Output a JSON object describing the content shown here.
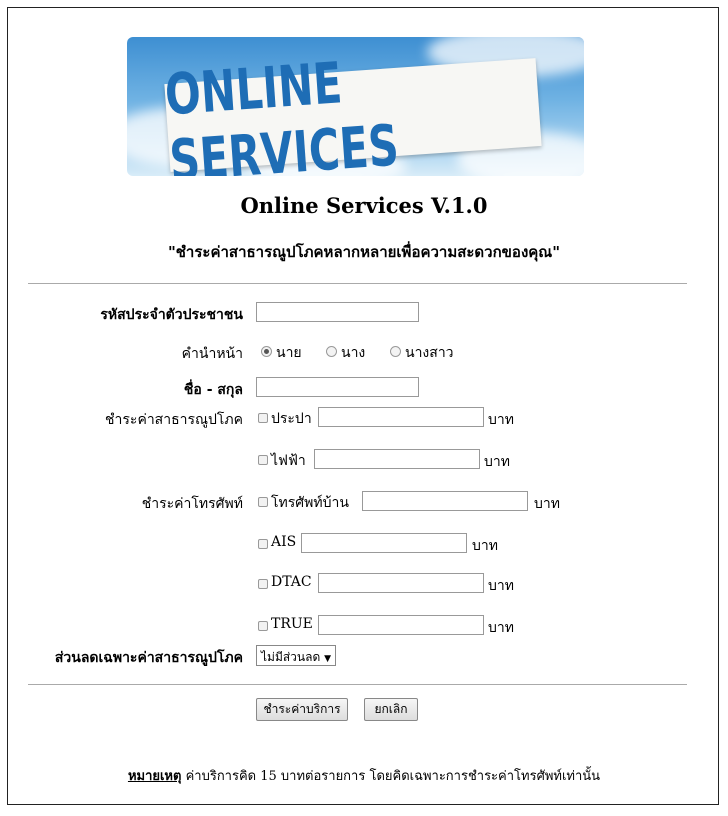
{
  "banner": {
    "text": "ONLINE SERVICES"
  },
  "header": {
    "title": "Online Services V.1.0",
    "slogan": "\"ชำระค่าสาธารณูปโภคหลากหลายเพื่อความสะดวกของคุณ\""
  },
  "form": {
    "id_label": "รหัสประจำตัวประชาชน",
    "prefix_label": "คำนำหน้า",
    "prefix_options": [
      "นาย",
      "นาง",
      "นางสาว"
    ],
    "prefix_selected": "นาย",
    "name_label": "ชื่อ - สกุล",
    "utility_label": "ชำระค่าสาธารณูปโภค",
    "phone_label": "ชำระค่าโทรศัพท์",
    "unit": "บาท",
    "items": {
      "water": "ประปา",
      "electric": "ไฟฟ้า",
      "homephone": "โทรศัพท์บ้าน",
      "ais": "AIS",
      "dtac": "DTAC",
      "true": "TRUE"
    },
    "discount_label": "ส่วนลดเฉพาะค่าสาธารณูปโภค",
    "discount_selected": "ไม่มีส่วนลด"
  },
  "buttons": {
    "submit": "ชำระค่าบริการ",
    "cancel": "ยกเลิก"
  },
  "note": {
    "label": "หมายเหตุ",
    "text": " ค่าบริการคิด 15 บาทต่อรายการ โดยคิดเฉพาะการชำระค่าโทรศัพท์เท่านั้น"
  }
}
